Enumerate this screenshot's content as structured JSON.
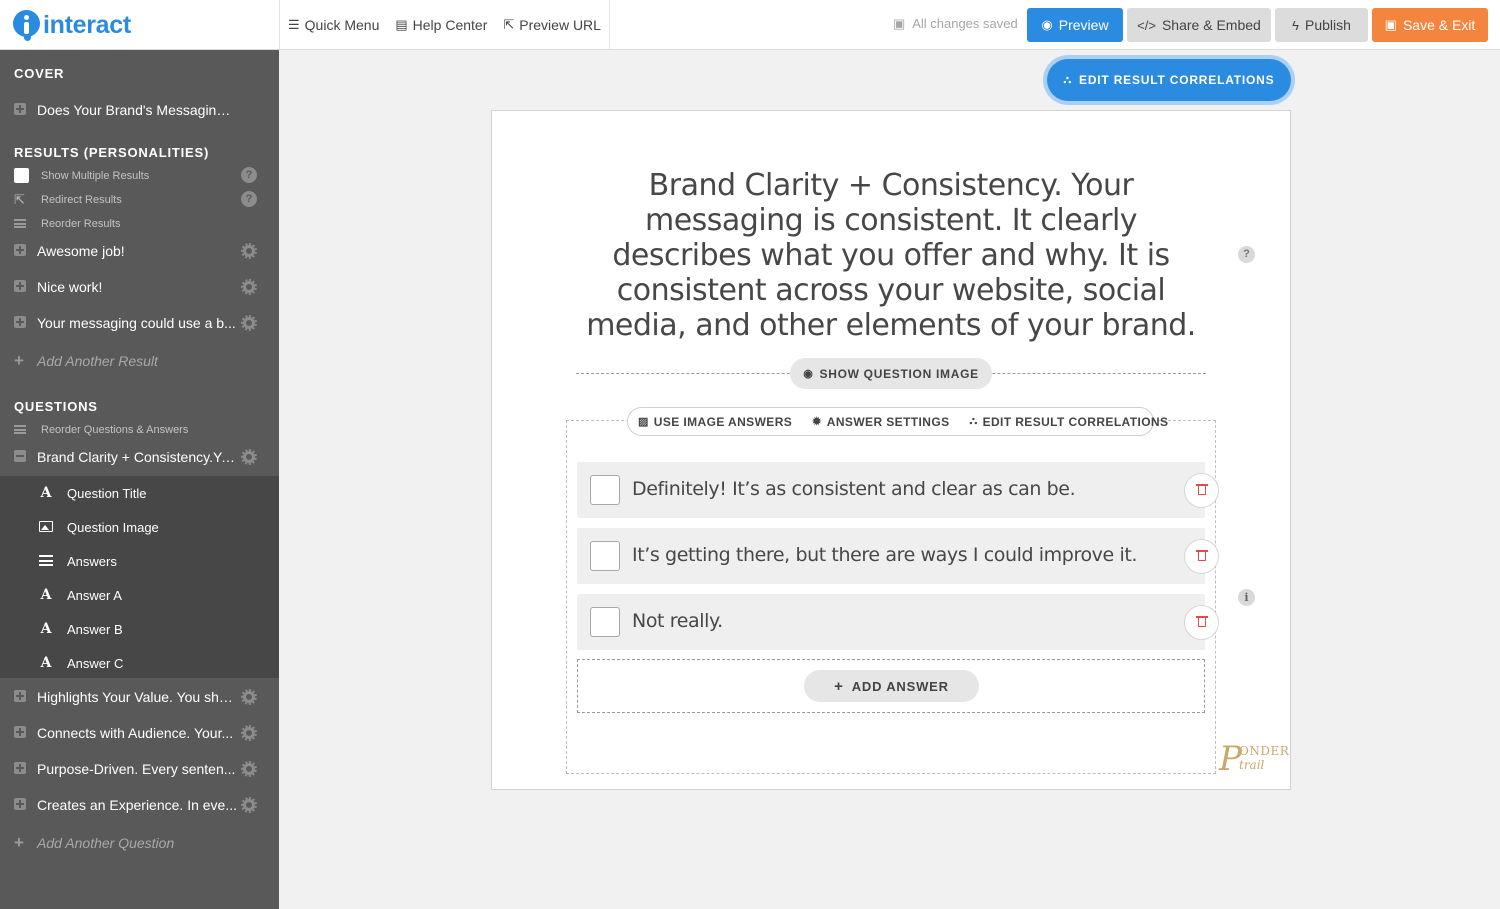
{
  "app": {
    "logo_text": "interact"
  },
  "topbar": {
    "quick_menu": "Quick Menu",
    "help_center": "Help Center",
    "preview_url": "Preview URL",
    "saved_status": "All changes saved",
    "preview": "Preview",
    "share_embed": "Share & Embed",
    "publish": "Publish",
    "save_exit": "Save & Exit"
  },
  "sidebar": {
    "cover_heading": "COVER",
    "cover_item": "Does Your Brand's Messaging ...",
    "results_heading": "RESULTS (PERSONALITIES)",
    "show_multiple_results": "Show Multiple Results",
    "redirect_results": "Redirect Results",
    "reorder_results": "Reorder Results",
    "results": [
      {
        "label": "Awesome job!"
      },
      {
        "label": "Nice work!"
      },
      {
        "label": "Your messaging could use a b..."
      }
    ],
    "add_result": "Add Another Result",
    "questions_heading": "QUESTIONS",
    "reorder_questions": "Reorder Questions & Answers",
    "questions": [
      {
        "label": "Brand Clarity + Consistency.Yo..."
      },
      {
        "label": "Highlights Your Value. You sho..."
      },
      {
        "label": "Connects with Audience. Your..."
      },
      {
        "label": "Purpose-Driven. Every senten..."
      },
      {
        "label": "Creates an Experience. In eve..."
      }
    ],
    "sub_items": {
      "question_title": "Question Title",
      "question_image": "Question Image",
      "answers": "Answers",
      "answer_a": "Answer A",
      "answer_b": "Answer B",
      "answer_c": "Answer C"
    },
    "add_question": "Add Another Question"
  },
  "editor": {
    "edit_result_correlations_top": "EDIT RESULT CORRELATIONS",
    "question_title": "Brand Clarity + Consistency. Your messaging is consistent. It clearly describes what you offer and why. It is consistent across your website, social media, and other elements of your brand.",
    "show_question_image": "SHOW QUESTION IMAGE",
    "toolbar": {
      "use_image_answers": "USE IMAGE ANSWERS",
      "answer_settings": "ANSWER SETTINGS",
      "edit_result_correlations": "EDIT RESULT CORRELATIONS"
    },
    "answers": [
      {
        "text": "Definitely! It’s as consistent and clear as can be."
      },
      {
        "text": "It’s getting there, but there are ways I could improve it."
      },
      {
        "text": "Not really."
      }
    ],
    "add_answer": "ADD ANSWER",
    "help_mark": "?",
    "info_mark": "i",
    "brand_mark": {
      "letter": "P",
      "line1": "ONDER",
      "line2": "trail"
    }
  }
}
